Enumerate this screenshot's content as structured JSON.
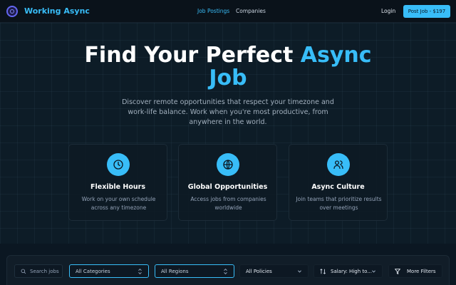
{
  "navbar": {
    "brand": "Working Async",
    "links": [
      {
        "label": "Job Postings",
        "active": true
      },
      {
        "label": "Companies",
        "active": false
      }
    ],
    "login": "Login",
    "post_job": "Post Job - $197"
  },
  "hero": {
    "title_main": "Find Your Perfect ",
    "title_accent_1": "Async",
    "title_accent_2": "Job",
    "subtitle": "Discover remote opportunities that respect your timezone and work-life balance. Work when you're most productive, from anywhere in the world."
  },
  "features": [
    {
      "icon": "clock-icon",
      "title": "Flexible Hours",
      "desc": "Work on your own schedule across any timezone"
    },
    {
      "icon": "globe-icon",
      "title": "Global Opportunities",
      "desc": "Access jobs from companies worldwide"
    },
    {
      "icon": "users-icon",
      "title": "Async Culture",
      "desc": "Join teams that prioritize results over meetings"
    }
  ],
  "filters": {
    "search_placeholder": "Search jobs",
    "category": "All Categories",
    "region": "All Regions",
    "policy": "All Policies",
    "sort": "Salary: High to...",
    "more": "More Filters"
  },
  "colors": {
    "accent": "#38bdf8",
    "background": "#0b1722"
  }
}
